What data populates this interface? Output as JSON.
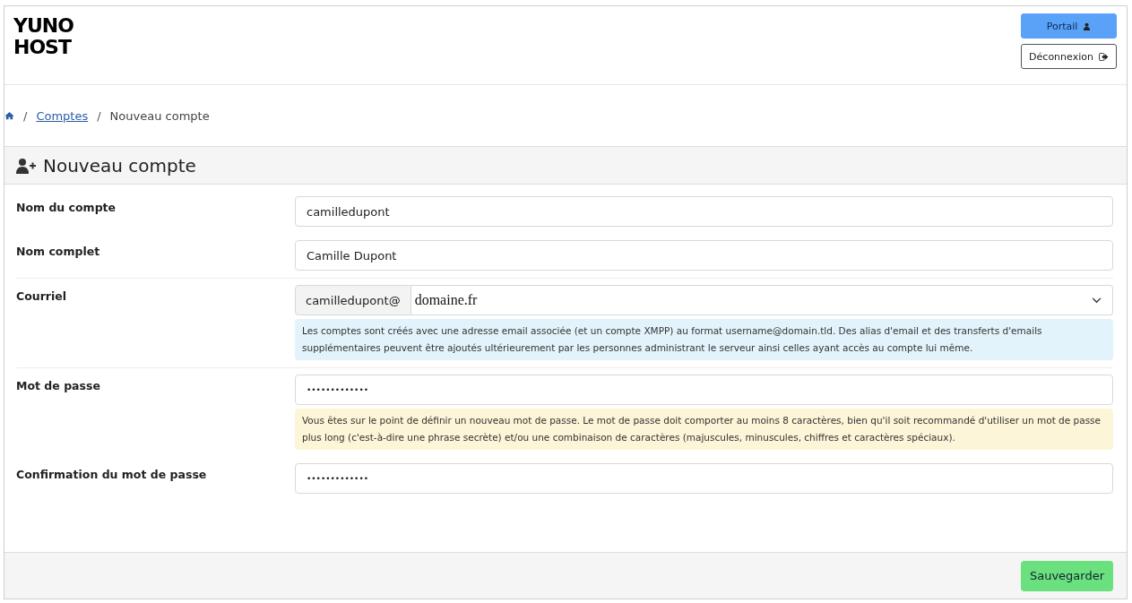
{
  "logo": {
    "line_1": "YUNO",
    "line_2": "HOST"
  },
  "header_buttons": [
    {
      "label": "Portail",
      "kind": "primary"
    },
    {
      "label": "Déconnexion",
      "kind": "outline"
    }
  ],
  "breadcrumb": {
    "separator": "/",
    "links": [
      "Comptes"
    ],
    "current": "Nouveau compte"
  },
  "card": {
    "title": "Nouveau compte",
    "groups": [
      {
        "fields": [
          {
            "label": "Nom du compte",
            "kind": "text",
            "value": "camilledupont"
          },
          {
            "label": "Nom complet",
            "kind": "text",
            "value": "Camille Dupont"
          }
        ]
      },
      {
        "fields": [
          {
            "label": "Courriel",
            "kind": "email",
            "prefix": "camilledupont@",
            "value": "domaine.fr",
            "help": {
              "kind": "info",
              "text": "Les comptes sont créés avec une adresse email associée (et un compte XMPP) au format username@domain.tld. Des alias d'email et des transferts d'emails supplémentaires peuvent être ajoutés ultérieurement par les personnes administrant le serveur ainsi celles ayant accès au compte lui même."
            }
          }
        ]
      },
      {
        "fields": [
          {
            "label": "Mot de passe",
            "kind": "password",
            "value": "•••••••••••••",
            "help": {
              "kind": "warning",
              "text": "Vous êtes sur le point de définir un nouveau mot de passe. Le mot de passe doit comporter au moins 8 caractères, bien qu'il soit recommandé d'utiliser un mot de passe plus long (c'est-à-dire une phrase secrète) et/ou une combinaison de caractères (majuscules, minuscules, chiffres et caractères spéciaux)."
            }
          },
          {
            "label": "Confirmation du mot de passe",
            "kind": "password",
            "value": "•••••••••••••"
          }
        ]
      }
    ],
    "submit": "Sauvegarder"
  }
}
